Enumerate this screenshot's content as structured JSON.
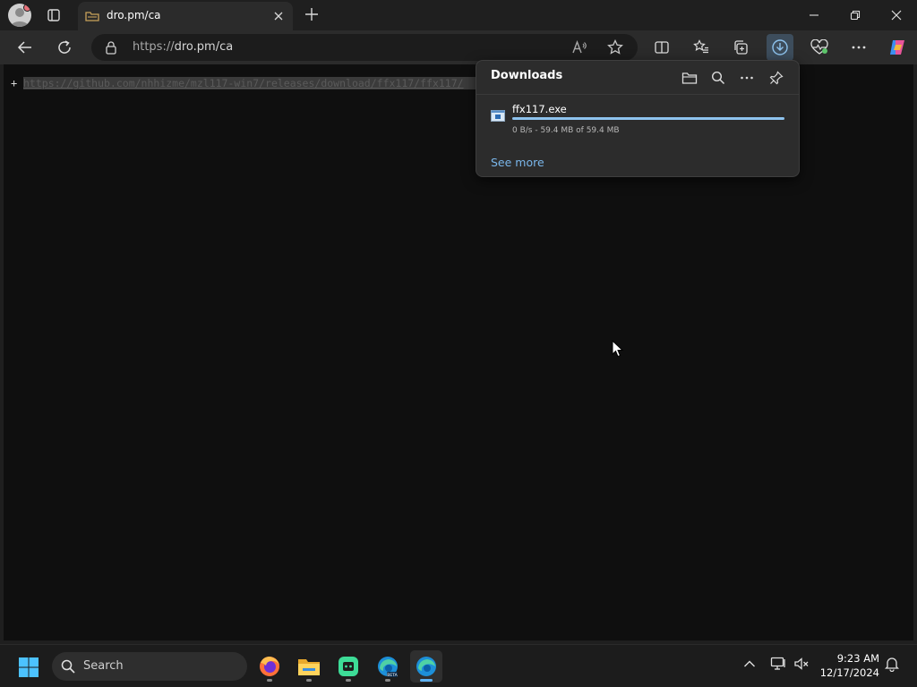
{
  "tab": {
    "title": "dro.pm/ca"
  },
  "address_bar": {
    "url_scheme": "https://",
    "url_rest": "dro.pm/ca"
  },
  "page": {
    "prefix": "+",
    "link_text": "https://github.com/nhhizme/mzl117-win7/releases/download/ffx117/ffx117/"
  },
  "downloads": {
    "title": "Downloads",
    "items": [
      {
        "file_name": "ffx117.exe",
        "status": "0 B/s - 59.4 MB of 59.4 MB",
        "progress": 1.0
      }
    ],
    "see_more": "See more"
  },
  "taskbar": {
    "search_label": "Search",
    "time": "9:23 AM",
    "date": "12/17/2024",
    "apps": [
      "firefox-icon",
      "file-explorer-icon",
      "chat-app-icon",
      "edge-beta-icon",
      "edge-icon"
    ]
  },
  "colors": {
    "accent": "#5fb2f2",
    "link": "#7ab6ea",
    "progress": "#8ec3ee",
    "background": "#0f0f0f"
  }
}
